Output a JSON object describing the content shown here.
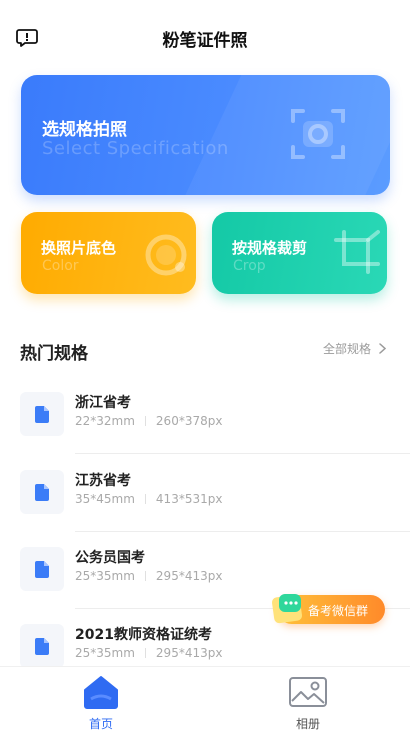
{
  "header": {
    "title": "粉笔证件照",
    "feedback_icon": "feedback-icon"
  },
  "cards": {
    "main": {
      "title": "选规格拍照",
      "subtitle": "Select Specification",
      "icon": "camera-scan-icon",
      "color": "#3a7bfb"
    },
    "color": {
      "title": "换照片底色",
      "subtitle": "Color",
      "icon": "palette-icon",
      "color": "#ffab00"
    },
    "crop": {
      "title": "按规格裁剪",
      "subtitle": "Crop",
      "icon": "crop-icon",
      "color": "#14c9a6"
    }
  },
  "section": {
    "title": "热门规格",
    "more_label": "全部规格"
  },
  "specs": [
    {
      "name": "浙江省考",
      "size_mm": "22*32mm",
      "size_px": "260*378px"
    },
    {
      "name": "江苏省考",
      "size_mm": "35*45mm",
      "size_px": "413*531px"
    },
    {
      "name": "公务员国考",
      "size_mm": "25*35mm",
      "size_px": "295*413px"
    },
    {
      "name": "2021教师资格证统考",
      "size_mm": "25*35mm",
      "size_px": "295*413px"
    }
  ],
  "float_button": {
    "label": "备考微信群",
    "icon": "wechat-group-icon"
  },
  "tabbar": {
    "items": [
      {
        "label": "首页",
        "icon": "home-icon",
        "active": true
      },
      {
        "label": "相册",
        "icon": "album-icon",
        "active": false
      }
    ],
    "active_color": "#2f6bf2"
  }
}
